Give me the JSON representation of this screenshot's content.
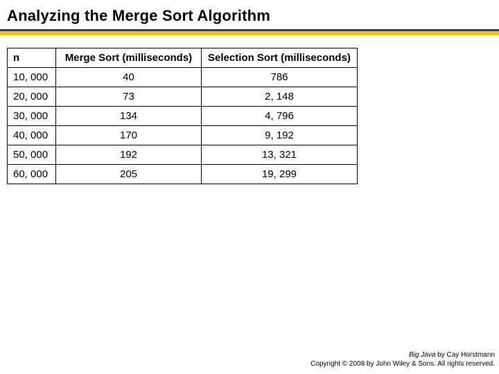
{
  "title": "Analyzing the Merge Sort Algorithm",
  "chart_data": {
    "type": "table",
    "columns": [
      "n",
      "Merge Sort (milliseconds)",
      "Selection Sort (milliseconds)"
    ],
    "rows": [
      {
        "n": "10, 000",
        "merge": "40",
        "selection": "786"
      },
      {
        "n": "20, 000",
        "merge": "73",
        "selection": "2, 148"
      },
      {
        "n": "30, 000",
        "merge": "134",
        "selection": "4, 796"
      },
      {
        "n": "40, 000",
        "merge": "170",
        "selection": "9, 192"
      },
      {
        "n": "50, 000",
        "merge": "192",
        "selection": "13, 321"
      },
      {
        "n": "60, 000",
        "merge": "205",
        "selection": "19, 299"
      }
    ]
  },
  "footer": {
    "book": "Big Java",
    "byline": " by Cay Horstmann",
    "copyright": "Copyright © 2008 by John Wiley & Sons.  All rights reserved."
  }
}
